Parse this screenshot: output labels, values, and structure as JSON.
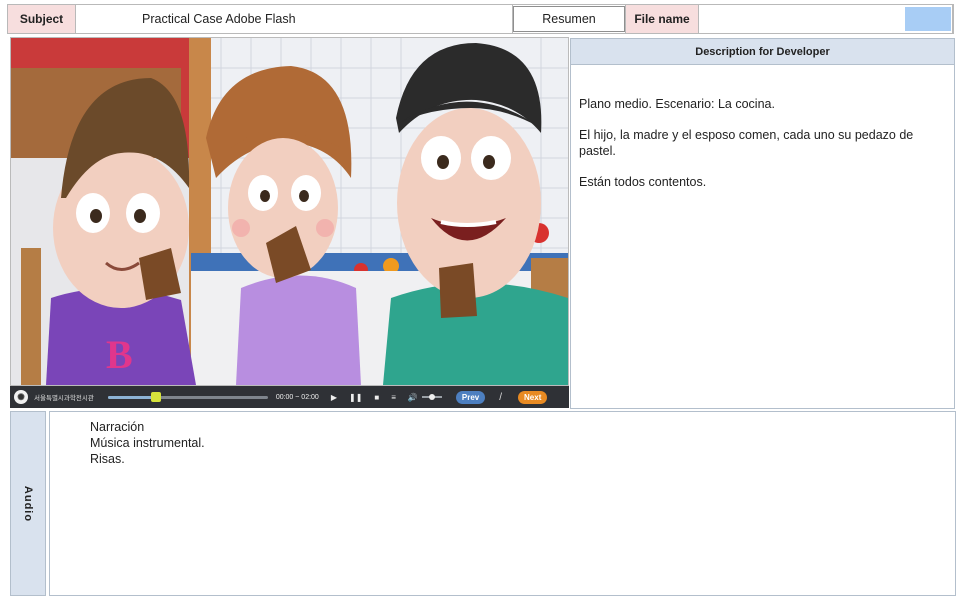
{
  "header": {
    "subject_label": "Subject",
    "subject_value": "Practical Case Adobe Flash",
    "resumen": "Resumen",
    "filename_label": "File name",
    "filename_value": ""
  },
  "scene": {
    "description": "Animated kitchen scene: son, mother and father each eating a piece of cake"
  },
  "player": {
    "org_name": "서울특별시과학전시관",
    "time": "00:00 ~ 02:00",
    "progress": 0.3,
    "volume": 0.5,
    "prev_label": "Prev",
    "slash": "/",
    "next_label": "Next"
  },
  "description_panel": {
    "title": "Description for Developer",
    "paragraphs": [
      "Plano medio. Escenario: La cocina.",
      "El hijo, la madre y el esposo comen, cada uno su pedazo de pastel.",
      "Están todos contentos."
    ]
  },
  "audio": {
    "label": "Audio",
    "lines": [
      "Narración",
      "Música instrumental.",
      "Risas."
    ]
  },
  "colors": {
    "label_pink": "#f7dede",
    "panel_blue": "#d9e2ee",
    "swatch_blue": "#a8cdf5",
    "player_bg": "#2f3136",
    "prev_blue": "#4d7fc0",
    "next_orange": "#e88a22"
  }
}
